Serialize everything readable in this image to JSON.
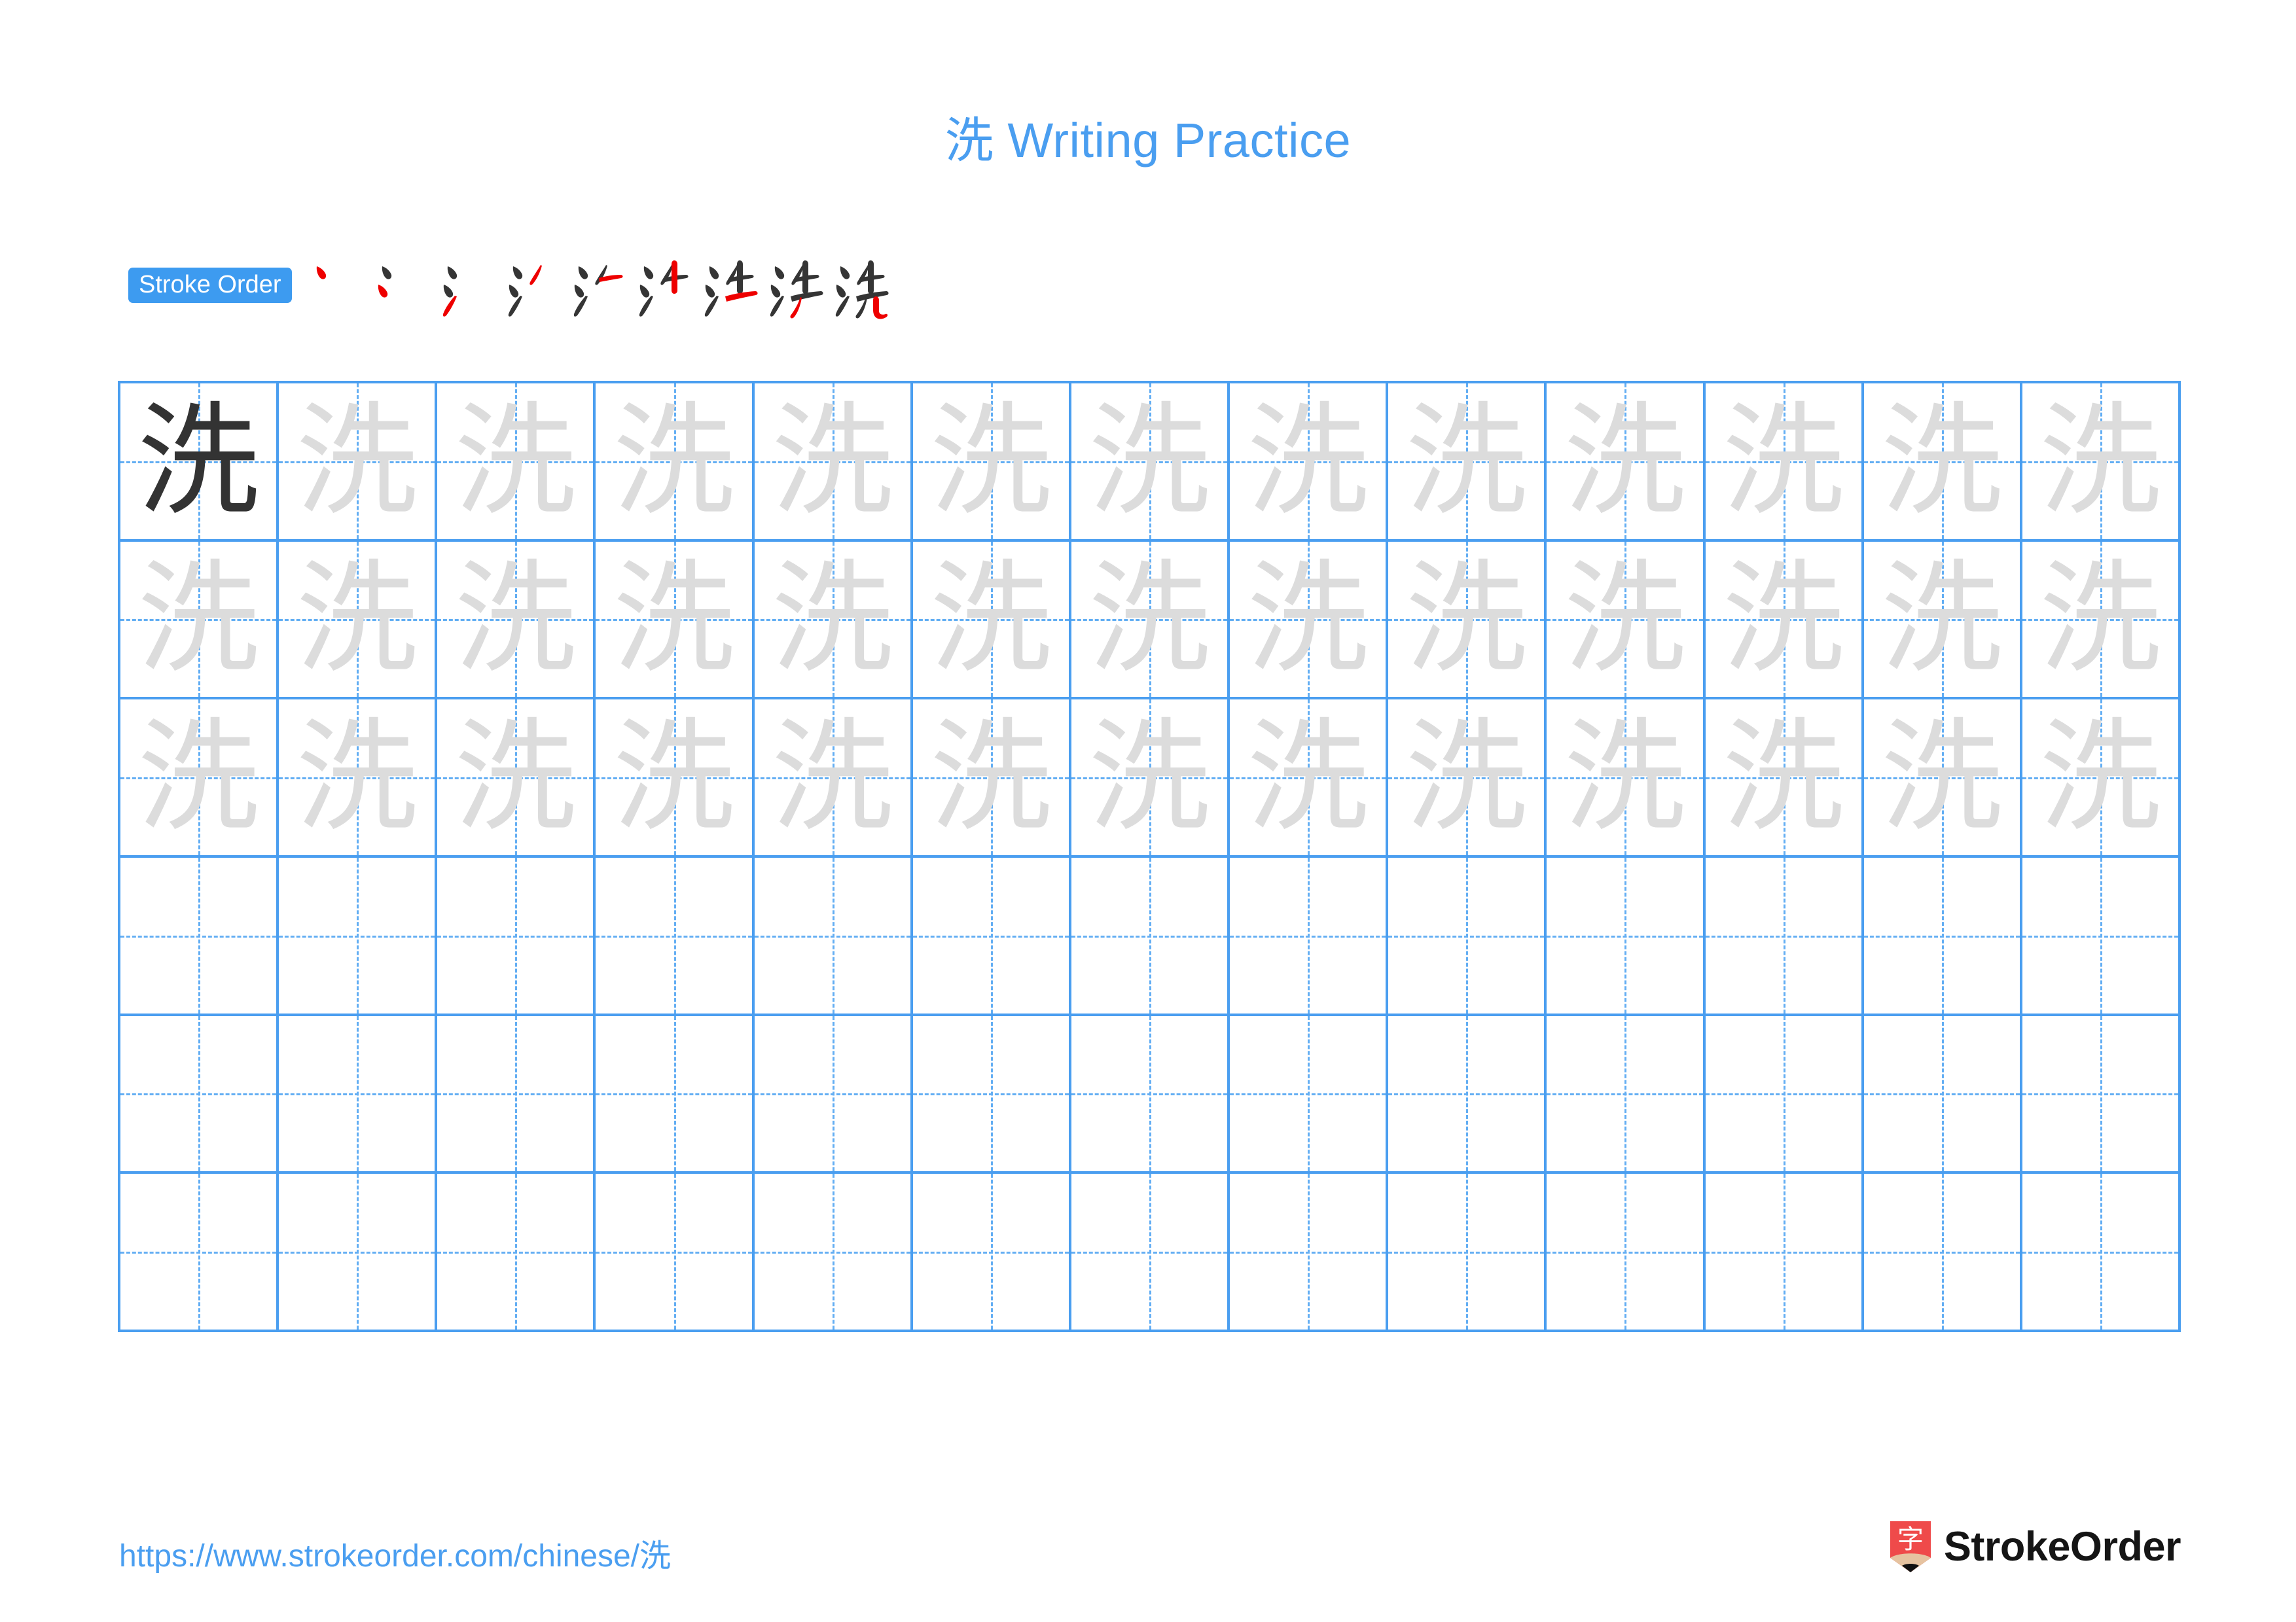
{
  "document": {
    "character": "洗",
    "title": "洗 Writing Practice",
    "title_color": "#4a9ef0",
    "background_color": "#ffffff"
  },
  "stroke_order": {
    "badge_label": "Stroke Order",
    "badge_bg_color": "#3d9bf0",
    "badge_text_color": "#ffffff",
    "new_stroke_color": "#ee0000",
    "done_stroke_color": "#353535",
    "total_strokes": 9,
    "steps": [
      {
        "index": 1,
        "label": "丶",
        "strokes_shown": 1,
        "new_stroke": "dot-upper-left"
      },
      {
        "index": 2,
        "label": "冫",
        "strokes_shown": 2,
        "new_stroke": "dot-middle-left"
      },
      {
        "index": 3,
        "label": "氵",
        "strokes_shown": 3,
        "new_stroke": "rising-stroke-lower-left"
      },
      {
        "index": 4,
        "label": "氵丿",
        "strokes_shown": 4,
        "new_stroke": "left-falling-upper-right"
      },
      {
        "index": 5,
        "label": "氵丿一",
        "strokes_shown": 5,
        "new_stroke": "horizontal-upper-right"
      },
      {
        "index": 6,
        "label": "汁",
        "strokes_shown": 6,
        "new_stroke": "vertical-right"
      },
      {
        "index": 7,
        "label": "洰",
        "strokes_shown": 7,
        "new_stroke": "horizontal-lower-right"
      },
      {
        "index": 8,
        "label": "涉",
        "strokes_shown": 8,
        "new_stroke": "left-falling-lower-right"
      },
      {
        "index": 9,
        "label": "洗",
        "strokes_shown": 9,
        "new_stroke": "vertical-hook-bottom-right"
      }
    ]
  },
  "practice_grid": {
    "columns": 13,
    "rows": 6,
    "border_color": "#4a9ef0",
    "guide_line_color": "#63aef3",
    "traced_character_color": "#dcdcdc",
    "model_character_color": "#333333",
    "model_cell": {
      "row": 1,
      "column": 1,
      "character": "洗"
    },
    "traced_rows": [
      1,
      2,
      3
    ],
    "blank_rows": [
      4,
      5,
      6
    ],
    "cell_character": "洗"
  },
  "footer": {
    "url": "https://www.strokeorder.com/chinese/洗",
    "url_color": "#4a9ef0",
    "logo": {
      "mark_character": "字",
      "mark_bg_color": "#ef4a4a",
      "mark_tip_color": "#e6c3a0",
      "wordmark": "StrokeOrder",
      "wordmark_color": "#151515"
    }
  }
}
